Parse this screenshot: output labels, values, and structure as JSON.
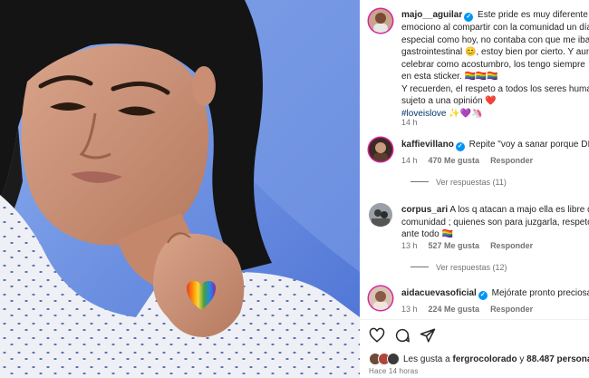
{
  "post": {
    "author": "majo__aguilar",
    "caption_lines": [
      "Este pride es muy diferente 🌈",
      "emociono al compartir con la comunidad un día",
      "especial como hoy, no contaba con que me iba",
      "gastrointestinal 😊, estoy bien por cierto. Y aun",
      "celebrar como acostumbro, los tengo siempre",
      "en esta sticker. 🏳️‍🌈🏳️‍🌈🏳️‍🌈",
      "Y recuerden, el respeto a todos los seres huma",
      "sujeto a una opinión ❤️"
    ],
    "hashtag": "#loveislove",
    "hashtag_emoji": "✨💜🦄",
    "time": "14 h"
  },
  "comments": [
    {
      "user": "kaffievillano",
      "text": "Repite \"voy a sanar porque DIO",
      "time": "14 h",
      "likes": "470 Me gusta",
      "reply": "Responder",
      "view_replies": "Ver respuestas (11)"
    },
    {
      "user": "corpus_ari",
      "text_lines": [
        "A los q atacan a majo ella es libre d",
        "comunidad ; quienes son para juzgarla, respeto",
        "ante todo 🏳️‍🌈"
      ],
      "time": "13 h",
      "likes": "527 Me gusta",
      "reply": "Responder",
      "view_replies": "Ver respuestas (12)"
    },
    {
      "user": "aidacuevasoficial",
      "text": "Mejórate pronto preciosa",
      "time": "13 h",
      "likes": "224 Me gusta",
      "reply": "Responder"
    }
  ],
  "actions": {
    "likes_prefix": "Les gusta a ",
    "liked_by_user": "fergrocolorado",
    "likes_joiner": " y ",
    "likes_count": "88.487 personas",
    "post_time": "Hace 14 horas"
  },
  "colors": {
    "accent": "#0095f6",
    "muted": "#737373",
    "hashtag": "#00376b",
    "heart": "#ed4956"
  },
  "icons": [
    "verified-badge-icon",
    "heart-icon",
    "comment-icon",
    "share-icon"
  ]
}
